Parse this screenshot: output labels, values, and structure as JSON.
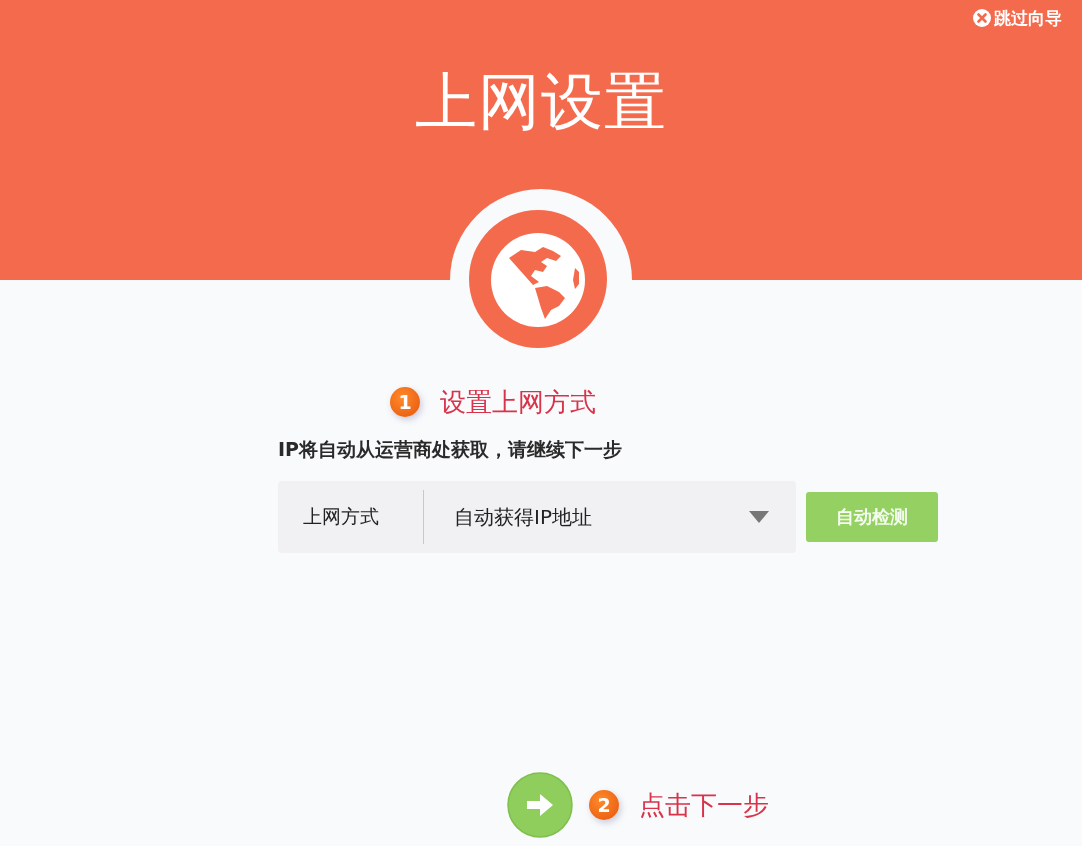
{
  "header": {
    "title": "上网设置",
    "skip_button": {
      "label": "跳过向导"
    }
  },
  "step_1": {
    "number": "1",
    "label": "设置上网方式"
  },
  "description": "IP将自动从运营商处获取，请继续下一步",
  "connection": {
    "label": "上网方式",
    "select": {
      "value": "自动获得IP地址"
    },
    "detect_button": {
      "label": "自动检测"
    }
  },
  "step_2": {
    "number": "2",
    "label": "点击下一步"
  }
}
